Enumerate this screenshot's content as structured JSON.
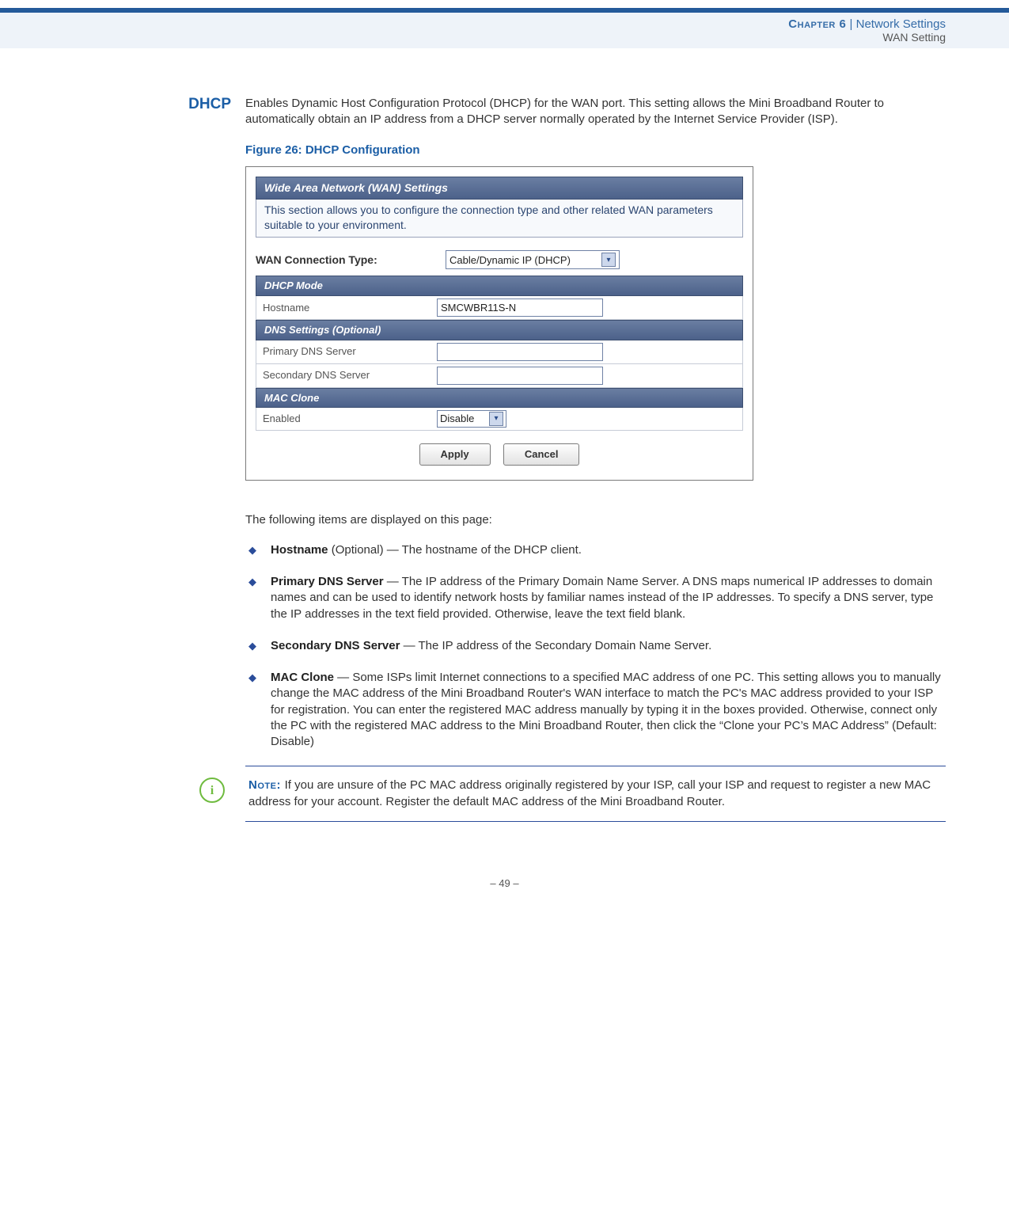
{
  "header": {
    "chapter_label": "Chapter 6",
    "sep": "  |  ",
    "chapter_title": "Network Settings",
    "subtitle": "WAN Setting"
  },
  "margin": {
    "dhcp_heading": "DHCP"
  },
  "intro_para": "Enables Dynamic Host Configuration Protocol (DHCP) for the WAN port. This setting allows the Mini Broadband Router to automatically obtain an IP address from a DHCP server normally operated by the Internet Service Provider (ISP).",
  "figure": {
    "caption": "Figure 26:  DHCP Configuration",
    "panel_title": "Wide Area Network (WAN) Settings",
    "panel_desc": "This section allows you to configure the connection type and other related WAN parameters suitable to your environment.",
    "conn_type_label": "WAN Connection Type:",
    "conn_type_value": "Cable/Dynamic IP (DHCP)",
    "section_dhcp": "DHCP Mode",
    "hostname_label": "Hostname",
    "hostname_value": "SMCWBR11S-N",
    "section_dns": "DNS Settings (Optional)",
    "primary_dns_label": "Primary DNS Server",
    "secondary_dns_label": "Secondary DNS Server",
    "section_mac": "MAC Clone",
    "enabled_label": "Enabled",
    "enabled_value": "Disable",
    "apply_btn": "Apply",
    "cancel_btn": "Cancel"
  },
  "after_fig_para": "The following items are displayed on this page:",
  "bullets": [
    {
      "term": "Hostname",
      "rest": " (Optional) — The hostname of the DHCP client."
    },
    {
      "term": "Primary DNS Server",
      "rest": " — The IP address of the Primary Domain Name Server. A DNS maps numerical IP addresses to domain names and can be used to identify network hosts by familiar names instead of the IP addresses. To specify a DNS server, type the IP addresses in the text field provided. Otherwise, leave the text field blank."
    },
    {
      "term": "Secondary DNS Server",
      "rest": " — The IP address of the Secondary Domain Name Server."
    },
    {
      "term": "MAC Clone",
      "rest": " — Some ISPs limit Internet connections to a specified MAC address of one PC. This setting allows you to manually change the MAC address of the Mini Broadband Router's WAN interface to match the PC's MAC address provided to your ISP for registration. You can enter the registered MAC address manually by typing it in the boxes provided. Otherwise, connect only the PC with the registered MAC address to the Mini Broadband Router, then click the “Clone your PC’s MAC Address” (Default: Disable)"
    }
  ],
  "note": {
    "label": "Note: ",
    "text": "If you are unsure of the PC MAC address originally registered by your ISP, call your ISP and request to register a new MAC address for your account. Register the default MAC address of the Mini Broadband Router."
  },
  "footer": "–  49  –"
}
